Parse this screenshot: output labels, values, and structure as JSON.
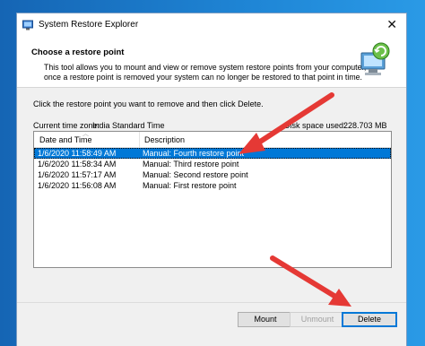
{
  "window": {
    "title": "System Restore Explorer",
    "close_glyph": "✕"
  },
  "header": {
    "title": "Choose a restore point",
    "description": "This tool allows you to mount and view or remove system restore points from your computer, once a restore point is removed your system can no longer be restored to that point in time.",
    "icon": "restore-computer-icon"
  },
  "instruction": "Click the restore point you want to remove and then click Delete.",
  "timezone": {
    "label": "Current time zone:",
    "value": "India Standard Time"
  },
  "disk": {
    "label": "Disk space used:",
    "value": "228.703 MB"
  },
  "list": {
    "columns": [
      "Date and Time",
      "Description"
    ],
    "rows": [
      {
        "date": "1/6/2020 11:58:49 AM",
        "description": "Manual: Fourth restore point",
        "selected": true
      },
      {
        "date": "1/6/2020 11:58:34 AM",
        "description": "Manual: Third restore point",
        "selected": false
      },
      {
        "date": "1/6/2020 11:57:17 AM",
        "description": "Manual: Second restore point",
        "selected": false
      },
      {
        "date": "1/6/2020 11:56:08 AM",
        "description": "Manual: First restore point",
        "selected": false
      }
    ]
  },
  "buttons": {
    "mount": "Mount",
    "unmount": "Unmount",
    "delete": "Delete"
  },
  "colors": {
    "selection": "#0078d7",
    "annotation_arrow": "#e53935"
  }
}
